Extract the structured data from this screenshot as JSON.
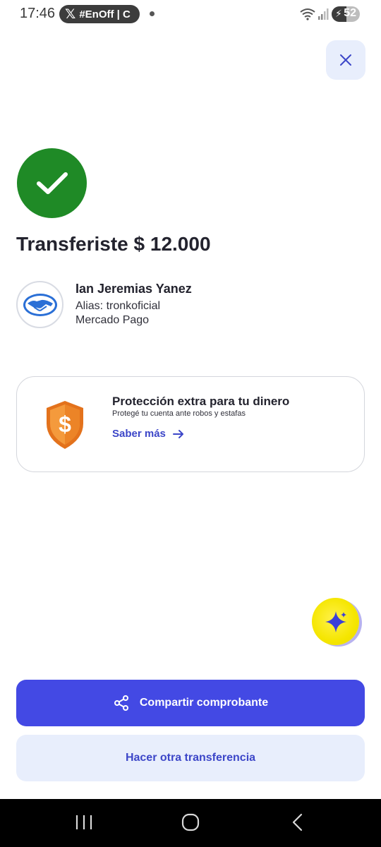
{
  "status_bar": {
    "time": "17:46",
    "notification_text": "#EnOff | C",
    "notification_app_icon": "x-logo-icon",
    "battery_level": "52",
    "battery_fill_fraction": 0.52
  },
  "header": {
    "close_icon": "close-icon"
  },
  "success": {
    "icon": "check-icon",
    "color": "#1f8a26",
    "title": "Transferiste $ 12.000"
  },
  "recipient": {
    "name": "Ian Jeremias Yanez",
    "alias": "Alias: tronkoficial",
    "bank": "Mercado Pago",
    "avatar_icon": "mercado-pago-handshake-icon"
  },
  "protection_card": {
    "icon": "shield-dollar-icon",
    "title": "Protección extra para tu dinero",
    "subtitle": "Protegé tu cuenta ante robos y estafas",
    "link_label": "Saber más",
    "link_icon": "arrow-right-icon"
  },
  "assistant": {
    "icon": "sparkle-icon"
  },
  "actions": {
    "share_label": "Compartir comprobante",
    "share_icon": "share-icon",
    "another_transfer_label": "Hacer otra transferencia",
    "primary_color": "#4349e4"
  },
  "nav": {
    "recent_icon": "recent-apps-icon",
    "home_icon": "home-icon",
    "back_icon": "back-icon"
  }
}
